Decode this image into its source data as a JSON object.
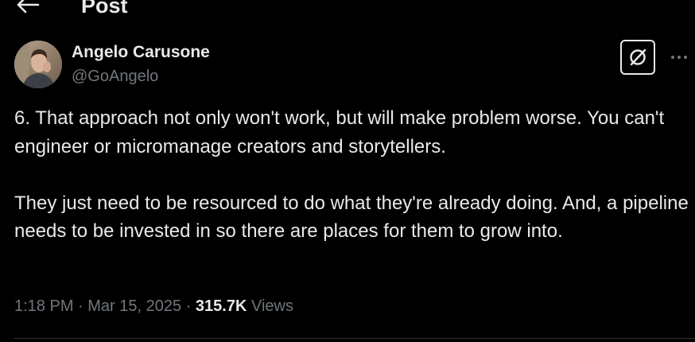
{
  "header": {
    "title": "Post",
    "back_icon": "arrow-left-icon"
  },
  "author": {
    "name": "Angelo Carusone",
    "handle": "@GoAngelo",
    "avatar": "avatar-photo"
  },
  "actions": {
    "grok_icon": "grok-icon",
    "more_icon": "more-horizontal-icon"
  },
  "tweet": {
    "paragraphs": [
      "6. That approach not only won't work, but will make problem worse. You can't engineer or micromanage creators and storytellers.",
      "They just need to be resourced to do what they're already doing. And, a pipeline needs to be invested in so there are places for them to grow into."
    ]
  },
  "meta": {
    "time": "1:18 PM",
    "separator": " · ",
    "date": "Mar 15, 2025",
    "views_count": "315.7K",
    "views_label": " Views"
  },
  "colors": {
    "background": "#000000",
    "text_primary": "#e7e9ea",
    "text_secondary": "#71767b",
    "divider": "#2f3336"
  }
}
